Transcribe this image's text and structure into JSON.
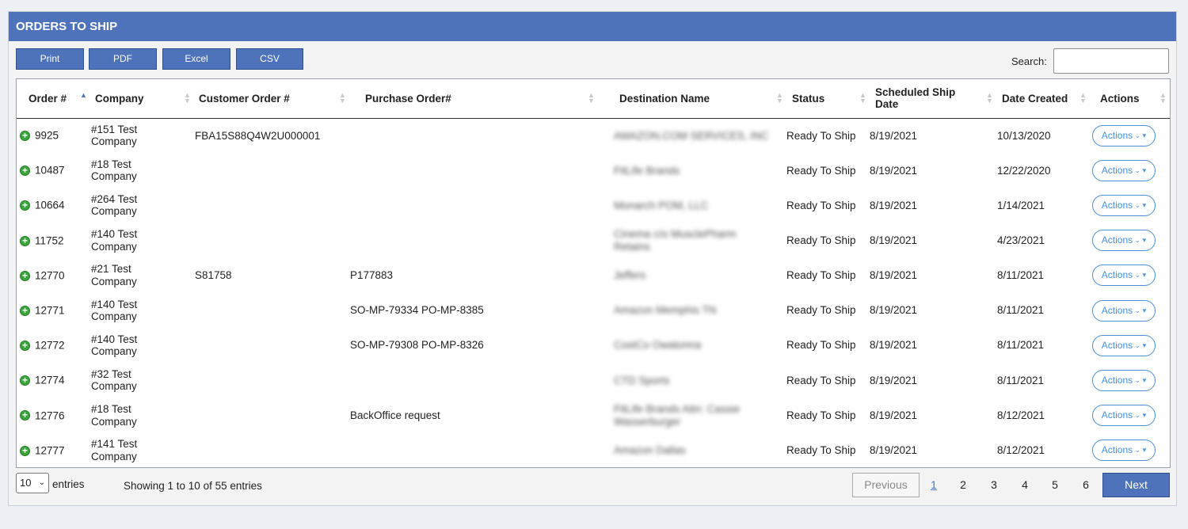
{
  "panel": {
    "title": "ORDERS TO SHIP"
  },
  "toolbar": {
    "buttons": [
      "Print",
      "PDF",
      "Excel",
      "CSV"
    ],
    "search_label": "Search:",
    "search_value": ""
  },
  "table": {
    "columns": [
      "Order #",
      "Company",
      "Customer Order #",
      "Purchase Order#",
      "Destination Name",
      "Status",
      "Scheduled Ship Date",
      "Date Created",
      "Actions"
    ],
    "sorted_column": "Order #",
    "sort_direction": "ascending",
    "rows": [
      {
        "order": "9925",
        "company": "#151 Test Company",
        "customer_order": "FBA15S88Q4W2U000001",
        "purchase_order": "",
        "destination": "AMAZON.COM SERVICES, INC",
        "status": "Ready To Ship",
        "ship_date": "8/19/2021",
        "created": "10/13/2020",
        "action": "Actions"
      },
      {
        "order": "10487",
        "company": "#18 Test Company",
        "customer_order": "",
        "purchase_order": "",
        "destination": "FitLife Brands",
        "status": "Ready To Ship",
        "ship_date": "8/19/2021",
        "created": "12/22/2020",
        "action": "Actions"
      },
      {
        "order": "10664",
        "company": "#264 Test Company",
        "customer_order": "",
        "purchase_order": "",
        "destination": "Monarch POM, LLC",
        "status": "Ready To Ship",
        "ship_date": "8/19/2021",
        "created": "1/14/2021",
        "action": "Actions"
      },
      {
        "order": "11752",
        "company": "#140 Test Company",
        "customer_order": "",
        "purchase_order": "",
        "destination": "Cinema c/o MusclePharm Retains",
        "status": "Ready To Ship",
        "ship_date": "8/19/2021",
        "created": "4/23/2021",
        "action": "Actions"
      },
      {
        "order": "12770",
        "company": "#21 Test Company",
        "customer_order": "S81758",
        "purchase_order": "P177883",
        "destination": "Jeffers",
        "status": "Ready To Ship",
        "ship_date": "8/19/2021",
        "created": "8/11/2021",
        "action": "Actions"
      },
      {
        "order": "12771",
        "company": "#140 Test Company",
        "customer_order": "",
        "purchase_order": "SO-MP-79334 PO-MP-8385",
        "destination": "Amazon Memphis TN",
        "status": "Ready To Ship",
        "ship_date": "8/19/2021",
        "created": "8/11/2021",
        "action": "Actions"
      },
      {
        "order": "12772",
        "company": "#140 Test Company",
        "customer_order": "",
        "purchase_order": "SO-MP-79308 PO-MP-8326",
        "destination": "CostCo Owatonna",
        "status": "Ready To Ship",
        "ship_date": "8/19/2021",
        "created": "8/11/2021",
        "action": "Actions"
      },
      {
        "order": "12774",
        "company": "#32 Test Company",
        "customer_order": "",
        "purchase_order": "",
        "destination": "CTD Sports",
        "status": "Ready To Ship",
        "ship_date": "8/19/2021",
        "created": "8/11/2021",
        "action": "Actions"
      },
      {
        "order": "12776",
        "company": "#18 Test Company",
        "customer_order": "",
        "purchase_order": "BackOffice request",
        "destination": "FitLife Brands Attn: Cassie Wasserburger",
        "status": "Ready To Ship",
        "ship_date": "8/19/2021",
        "created": "8/12/2021",
        "action": "Actions"
      },
      {
        "order": "12777",
        "company": "#141 Test Company",
        "customer_order": "",
        "purchase_order": "",
        "destination": "Amazon Dallas",
        "status": "Ready To Ship",
        "ship_date": "8/19/2021",
        "created": "8/12/2021",
        "action": "Actions"
      }
    ]
  },
  "footer": {
    "page_length": "10",
    "entries_label": "entries",
    "info": "Showing 1 to 10 of 55 entries",
    "prev_label": "Previous",
    "pages": [
      "1",
      "2",
      "3",
      "4",
      "5",
      "6"
    ],
    "current_page": "1",
    "next_label": "Next"
  },
  "colors": {
    "header_blue": "#4e73bb",
    "action_blue": "#4a90d9",
    "plus_green": "#3aa53a"
  },
  "icons": {
    "expand": "plus-circle-icon",
    "sort": "sort-arrows-icon",
    "caret": "caret-down-icon"
  }
}
